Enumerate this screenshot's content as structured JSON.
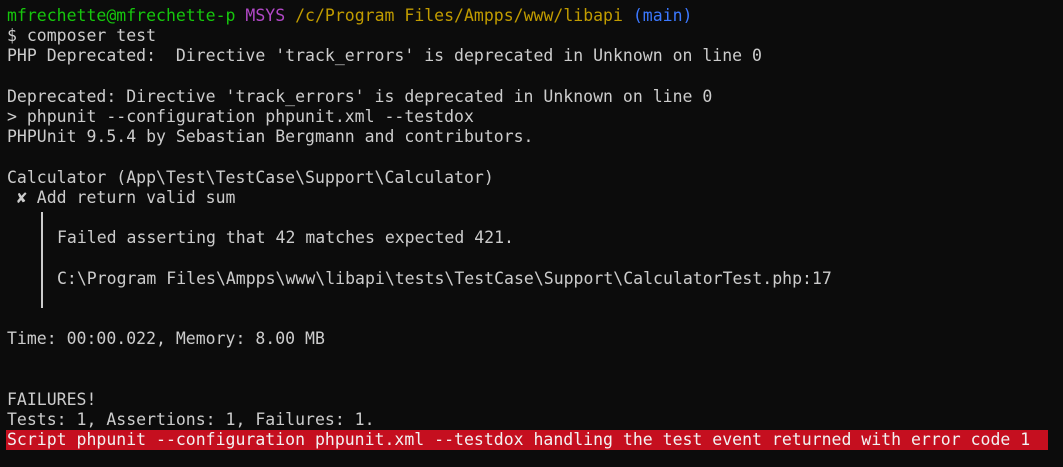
{
  "prompt": {
    "user_host": "mfrechette@mfrechette-p",
    "shell": "MSYS",
    "cwd": "/c/Program Files/Ampps/www/libapi",
    "branch": "(main)"
  },
  "command": "$ composer test",
  "output": {
    "php_deprecated_1": "PHP Deprecated:  Directive 'track_errors' is deprecated in Unknown on line 0",
    "php_deprecated_2": "Deprecated: Directive 'track_errors' is deprecated in Unknown on line 0",
    "script_invocation": "> phpunit --configuration phpunit.xml --testdox",
    "phpunit_banner": "PHPUnit 9.5.4 by Sebastian Bergmann and contributors.",
    "test_class": "Calculator (App\\Test\\TestCase\\Support\\Calculator)",
    "test_case": " ✘ Add return valid sum",
    "failure_message": "Failed asserting that 42 matches expected 421.",
    "failure_location": "C:\\Program Files\\Ampps\\www\\libapi\\tests\\TestCase\\Support\\CalculatorTest.php:17",
    "time_memory": "Time: 00:00.022, Memory: 8.00 MB",
    "failures_header": "FAILURES!",
    "summary": "Tests: 1, Assertions: 1, Failures: 1.",
    "error_line": "Script phpunit --configuration phpunit.xml --testdox handling the test event returned with error code 1"
  },
  "colors": {
    "background": "#0c0c0c",
    "text": "#cccccc",
    "user_host": "#16c60c",
    "shell": "#b148c6",
    "cwd": "#c19c00",
    "branch": "#3b78ff",
    "error_bg": "#c50f1f"
  }
}
